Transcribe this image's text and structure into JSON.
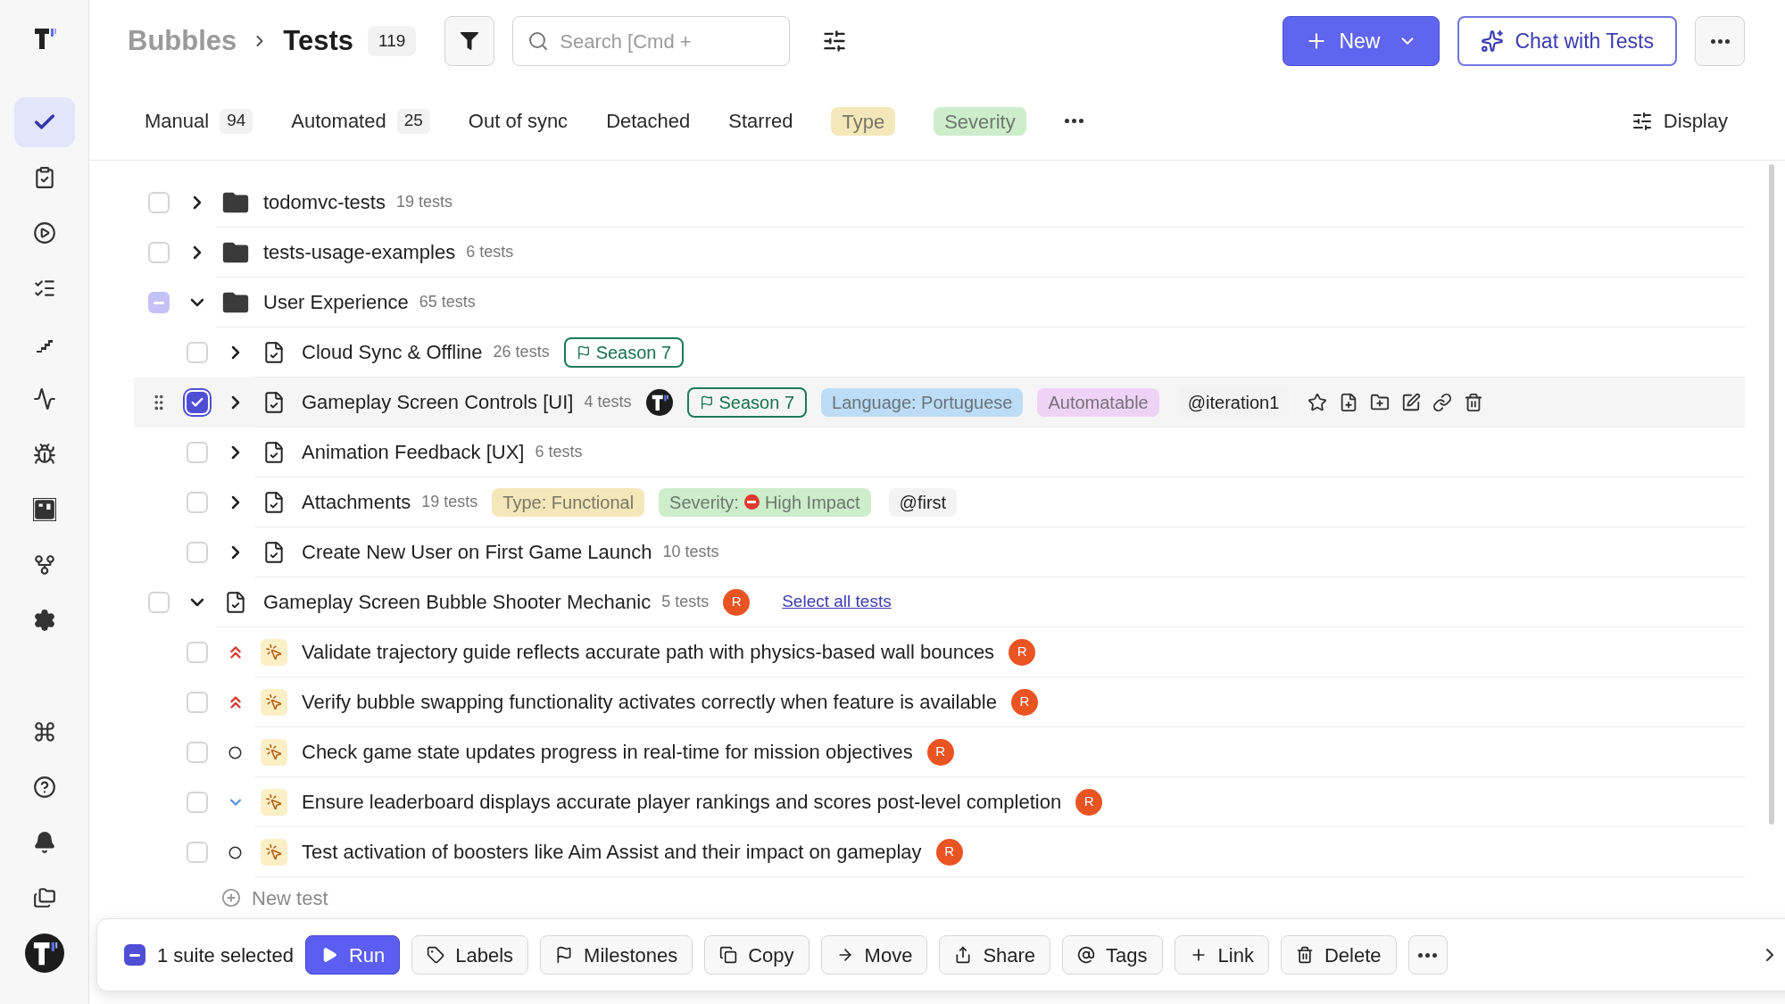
{
  "sidebar": {
    "items": [
      {
        "selected": true
      },
      {
        "selected": false
      },
      {
        "selected": false
      },
      {
        "selected": false
      },
      {
        "selected": false
      },
      {
        "selected": false
      },
      {
        "selected": false
      },
      {
        "selected": false
      },
      {
        "selected": false
      },
      {
        "selected": false
      },
      {
        "selected": false
      },
      {
        "selected": false
      },
      {
        "selected": false
      },
      {
        "selected": false
      }
    ]
  },
  "breadcrumb": {
    "project": "Bubbles",
    "page": "Tests",
    "count": "119"
  },
  "search": {
    "placeholder": "Search [Cmd +"
  },
  "actions": {
    "new": "New",
    "chat": "Chat with Tests"
  },
  "filters": [
    {
      "kind": "tab",
      "label": "Manual",
      "count": "94"
    },
    {
      "kind": "tab",
      "label": "Automated",
      "count": "25"
    },
    {
      "kind": "tab",
      "label": "Out of sync"
    },
    {
      "kind": "tab",
      "label": "Detached"
    },
    {
      "kind": "tab",
      "label": "Starred"
    },
    {
      "kind": "chip",
      "label": "Type",
      "color": "#f4e7b9"
    },
    {
      "kind": "chip",
      "label": "Severity",
      "color": "#cdedcb"
    },
    {
      "kind": "more"
    }
  ],
  "display": "Display",
  "tree": [
    {
      "kind": "folder",
      "name": "todomvc-tests",
      "count": "19 tests",
      "checked": false,
      "indeterminate": false,
      "expanded": false,
      "highlighted": false
    },
    {
      "kind": "folder",
      "name": "tests-usage-examples",
      "count": "6 tests",
      "checked": false,
      "indeterminate": false,
      "expanded": false,
      "highlighted": false
    },
    {
      "kind": "folder",
      "name": "User Experience",
      "count": "65 tests",
      "checked": true,
      "indeterminate": true,
      "expanded": true,
      "highlighted": false,
      "children": [
        {
          "kind": "suite",
          "name": "Cloud Sync & Offline",
          "count": "26 tests",
          "checked": false,
          "indeterminate": false,
          "expanded": false,
          "highlighted": false,
          "tags": [
            {
              "kind": "milestone",
              "text": "Season 7"
            }
          ]
        },
        {
          "kind": "suite",
          "name": "Gameplay Screen Controls [UI]",
          "count": "4 tests",
          "checked": true,
          "indeterminate": false,
          "expanded": false,
          "highlighted": true,
          "owner": {
            "kind": "logo"
          },
          "tags": [
            {
              "kind": "milestone",
              "text": "Season 7"
            },
            {
              "kind": "label",
              "text": "Language: Portuguese",
              "color": "#bddcf5"
            },
            {
              "kind": "label",
              "text": "Automatable",
              "color": "#efd3f6"
            },
            {
              "kind": "mention",
              "text": "@iteration1"
            }
          ]
        },
        {
          "kind": "suite",
          "name": "Animation Feedback [UX]",
          "count": "6 tests",
          "checked": false,
          "indeterminate": false,
          "expanded": false,
          "highlighted": false
        },
        {
          "kind": "suite",
          "name": "Attachments",
          "count": "19 tests",
          "checked": false,
          "indeterminate": false,
          "expanded": false,
          "highlighted": false,
          "tags": [
            {
              "kind": "label",
              "text": "Type: Functional",
              "color": "#f4e7b9"
            },
            {
              "kind": "severity",
              "prefix": "Severity:",
              "text": "High Impact",
              "color": "#cdedcb"
            },
            {
              "kind": "mention",
              "text": "@first"
            }
          ]
        },
        {
          "kind": "suite",
          "name": "Create New User on First Game Launch",
          "count": "10 tests",
          "checked": false,
          "indeterminate": false,
          "expanded": false,
          "highlighted": false
        }
      ]
    },
    {
      "kind": "suite",
      "name": "Gameplay Screen Bubble Shooter Mechanic",
      "count": "5 tests",
      "checked": false,
      "indeterminate": false,
      "expanded": true,
      "highlighted": false,
      "owner": {
        "kind": "initial",
        "initial": "R",
        "color": "#ea5423"
      },
      "link": "Select all tests",
      "children": [
        {
          "kind": "test",
          "name": "Validate trajectory guide reflects accurate path with physics-based wall bounces",
          "priority": {
            "kind": "high"
          },
          "checked": false,
          "indeterminate": false,
          "highlighted": false,
          "owner": {
            "kind": "initial",
            "initial": "R",
            "color": "#ea5423"
          }
        },
        {
          "kind": "test",
          "name": "Verify bubble swapping functionality activates correctly when feature is available",
          "priority": {
            "kind": "high"
          },
          "checked": false,
          "indeterminate": false,
          "highlighted": false,
          "owner": {
            "kind": "initial",
            "initial": "R",
            "color": "#ea5423"
          }
        },
        {
          "kind": "test",
          "name": "Check game state updates progress in real-time for mission objectives",
          "priority": {
            "kind": "none"
          },
          "checked": false,
          "indeterminate": false,
          "highlighted": false,
          "owner": {
            "kind": "initial",
            "initial": "R",
            "color": "#ea5423"
          }
        },
        {
          "kind": "test",
          "name": "Ensure leaderboard displays accurate player rankings and scores post-level completion",
          "priority": {
            "kind": "low"
          },
          "checked": false,
          "indeterminate": false,
          "highlighted": false,
          "owner": {
            "kind": "initial",
            "initial": "R",
            "color": "#ea5423"
          }
        },
        {
          "kind": "test",
          "name": "Test activation of boosters like Aim Assist and their impact on gameplay",
          "priority": {
            "kind": "none"
          },
          "checked": false,
          "indeterminate": false,
          "highlighted": false,
          "owner": {
            "kind": "initial",
            "initial": "R",
            "color": "#ea5423"
          }
        }
      ]
    }
  ],
  "new_test": "New test",
  "bulk_bar": {
    "checked": true,
    "indeterminate": true,
    "summary": "1 suite selected",
    "buttons": [
      {
        "kind": "run",
        "label": "Run"
      },
      {
        "kind": "labels",
        "label": "Labels"
      },
      {
        "kind": "milestones",
        "label": "Milestones"
      },
      {
        "kind": "copy",
        "label": "Copy"
      },
      {
        "kind": "move",
        "label": "Move"
      },
      {
        "kind": "share",
        "label": "Share"
      },
      {
        "kind": "tags",
        "label": "Tags"
      },
      {
        "kind": "link",
        "label": "Link"
      },
      {
        "kind": "delete",
        "label": "Delete"
      },
      {
        "kind": "more"
      }
    ]
  }
}
